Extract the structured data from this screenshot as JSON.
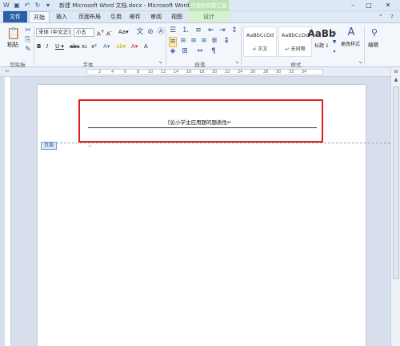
{
  "title": "新建 Microsoft Word 文档.docx - Microsoft Word",
  "contextual_title": "页眉和页脚工具",
  "tabs": [
    "文件",
    "开始",
    "插入",
    "页面布局",
    "引用",
    "邮件",
    "审阅",
    "视图",
    "设计"
  ],
  "clipboard": {
    "paste": "粘贴",
    "label": "剪贴板"
  },
  "font": {
    "name": "宋体 (中文正)",
    "size": "小五",
    "label": "字体"
  },
  "paragraph": {
    "label": "段落"
  },
  "styles": {
    "label": "样式",
    "items": [
      {
        "sample": "AaBbCcDd",
        "name": "↵ 正文"
      },
      {
        "sample": "AaBbCcDd",
        "name": "↵ 无间隔"
      },
      {
        "sample": "AaBb",
        "name": "标题 1"
      }
    ],
    "change_styles": "更改样式"
  },
  "editing": {
    "label": "编辑"
  },
  "header": {
    "text": "[论小学主应用题的题表性↵",
    "tag": "页眉",
    "para_mark": "↵"
  }
}
